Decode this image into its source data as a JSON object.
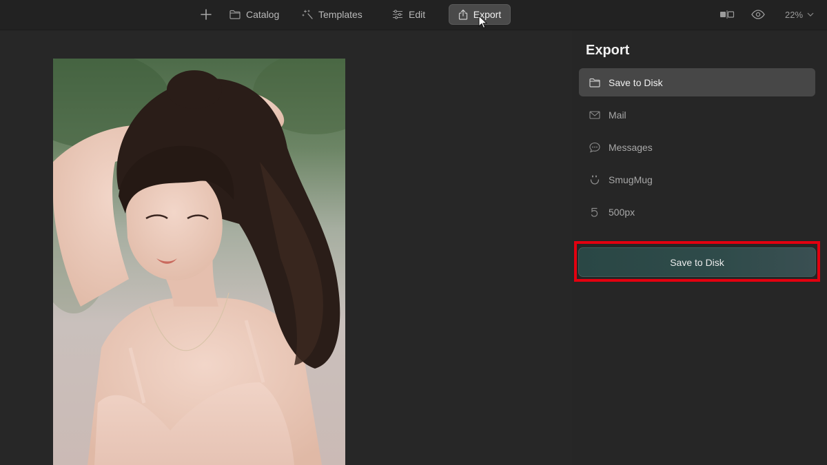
{
  "toolbar": {
    "catalog_label": "Catalog",
    "templates_label": "Templates",
    "edit_label": "Edit",
    "export_label": "Export",
    "zoom_label": "22%"
  },
  "panel": {
    "title": "Export",
    "destinations": [
      {
        "label": "Save to Disk",
        "icon": "folder-icon",
        "selected": true
      },
      {
        "label": "Mail",
        "icon": "mail-icon",
        "selected": false
      },
      {
        "label": "Messages",
        "icon": "messages-icon",
        "selected": false
      },
      {
        "label": "SmugMug",
        "icon": "smugmug-icon",
        "selected": false
      },
      {
        "label": "500px",
        "icon": "500px-icon",
        "selected": false
      }
    ],
    "action_label": "Save to Disk"
  },
  "colors": {
    "accent_button": "#2f4b4a",
    "highlight_frame": "#e3000f",
    "selected_row": "#474747"
  }
}
